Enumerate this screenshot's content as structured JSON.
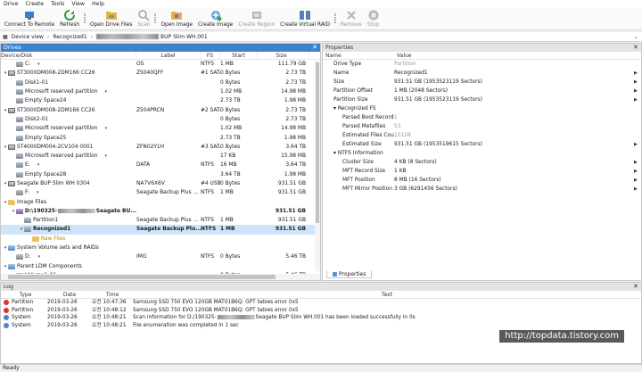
{
  "menu": [
    "Drive",
    "Create",
    "Tools",
    "View",
    "Help"
  ],
  "toolbar": [
    {
      "label": "Connect To Remote",
      "icon": "remote-icon",
      "color": "#3a7bd5",
      "disabled": false
    },
    {
      "label": "Refresh",
      "icon": "refresh-icon",
      "color": "#2e9b3a",
      "disabled": false
    },
    {
      "label": "Open Drive Files",
      "icon": "open-drive-icon",
      "color": "#e1b640",
      "disabled": false
    },
    {
      "label": "Scan",
      "icon": "scan-icon",
      "color": "#b5b5b5",
      "disabled": true
    },
    {
      "label": "Open Image",
      "icon": "open-image-icon",
      "color": "#e1b640",
      "disabled": false
    },
    {
      "label": "Create Image",
      "icon": "create-image-icon",
      "color": "#3aa34a",
      "disabled": false
    },
    {
      "label": "Create Region",
      "icon": "create-region-icon",
      "color": "#b5b5b5",
      "disabled": true
    },
    {
      "label": "Create Virtual RAID",
      "icon": "virtual-raid-icon",
      "color": "#5a7fb8",
      "disabled": false
    },
    {
      "label": "Remove",
      "icon": "remove-icon",
      "color": "#b5b5b5",
      "disabled": true
    },
    {
      "label": "Stop",
      "icon": "stop-icon",
      "color": "#b5b5b5",
      "disabled": true
    }
  ],
  "breadcrumb": {
    "device_view": "Device view",
    "recognized": "Recognized1",
    "image_tail": "BUP Slim WH.001"
  },
  "drives_pane": {
    "title": "Drives",
    "columns": [
      "Device/Disk",
      "Label",
      "FS",
      "Start",
      "Size"
    ],
    "rows": [
      {
        "indent": 1,
        "icon": "part",
        "name": "C:",
        "dd": true,
        "label": "OS",
        "fs": "NTFS",
        "start": "1 MB",
        "size": "111.79 GB"
      },
      {
        "indent": 0,
        "icon": "disk",
        "name": "ST3000DM008-2DM166 CC26",
        "tw": "v",
        "label": "Z5040QFF",
        "fs": "#1 SATA2...",
        "start": "0 Bytes",
        "size": "2.73 TB"
      },
      {
        "indent": 1,
        "icon": "part",
        "name": "Disk1-01",
        "label": "",
        "fs": "",
        "start": "0 Bytes",
        "size": "2.73 TB"
      },
      {
        "indent": 1,
        "icon": "part",
        "name": "Microsoft reserved partition",
        "dd": true,
        "label": "",
        "fs": "",
        "start": "1.02 MB",
        "size": "14.98 MB"
      },
      {
        "indent": 1,
        "icon": "part",
        "name": "Empty Space24",
        "label": "",
        "fs": "",
        "start": "2.73 TB",
        "size": "1.98 MB"
      },
      {
        "indent": 0,
        "icon": "disk",
        "name": "ST3000DM008-2DM166 CC26",
        "tw": "v",
        "label": "Z504PRCN",
        "fs": "#2 SATA2...",
        "start": "0 Bytes",
        "size": "2.73 TB"
      },
      {
        "indent": 1,
        "icon": "part",
        "name": "Disk2-01",
        "label": "",
        "fs": "",
        "start": "0 Bytes",
        "size": "2.73 TB"
      },
      {
        "indent": 1,
        "icon": "part",
        "name": "Microsoft reserved partition",
        "dd": true,
        "label": "",
        "fs": "",
        "start": "1.02 MB",
        "size": "14.98 MB"
      },
      {
        "indent": 1,
        "icon": "part",
        "name": "Empty Space25",
        "label": "",
        "fs": "",
        "start": "2.73 TB",
        "size": "1.98 MB"
      },
      {
        "indent": 0,
        "icon": "disk",
        "name": "ST4000DM004-2CV104 0001",
        "tw": "v",
        "label": "ZFN02Y1H",
        "fs": "#3 SATA2...",
        "start": "0 Bytes",
        "size": "3.64 TB"
      },
      {
        "indent": 1,
        "icon": "part",
        "name": "Microsoft reserved partition",
        "dd": true,
        "label": "",
        "fs": "",
        "start": "17 KB",
        "size": "15.98 MB"
      },
      {
        "indent": 1,
        "icon": "part",
        "name": "E:",
        "dd": true,
        "label": "DATA",
        "fs": "NTFS",
        "start": "16 MB",
        "size": "3.64 TB"
      },
      {
        "indent": 1,
        "icon": "part",
        "name": "Empty Space28",
        "label": "",
        "fs": "",
        "start": "3.64 TB",
        "size": "1.98 MB"
      },
      {
        "indent": 0,
        "icon": "disk",
        "name": "Seagate BUP Slim WH 0304",
        "tw": "v",
        "label": "NA7V6X6V",
        "fs": "#4 USB (...",
        "start": "0 Bytes",
        "size": "931.51 GB"
      },
      {
        "indent": 1,
        "icon": "part",
        "name": "F:",
        "dd": true,
        "label": "Seagate Backup Plus ...",
        "fs": "NTFS",
        "start": "1 MB",
        "size": "931.51 GB"
      },
      {
        "indent": 0,
        "icon": "folder",
        "name": "Image Files",
        "tw": "v",
        "label": "",
        "fs": "",
        "start": "",
        "size": ""
      },
      {
        "indent": 1,
        "icon": "img",
        "name": "D:\\190325-",
        "blur": true,
        "name_tail": "Seagate BU...",
        "tw": "v",
        "label": "",
        "fs": "",
        "start": "",
        "size": "931.51 GB",
        "bold": true
      },
      {
        "indent": 2,
        "icon": "part",
        "name": "Partition1",
        "label": "Seagate Backup Plus ...",
        "fs": "NTFS",
        "start": "1 MB",
        "size": "931.51 GB"
      },
      {
        "indent": 2,
        "icon": "part",
        "name": "Recognized1",
        "tw": "v",
        "label": "Seagate Backup Plu...",
        "fs": "NTFS",
        "start": "1 MB",
        "size": "931.51 GB",
        "sel": true,
        "bold": true
      },
      {
        "indent": 3,
        "icon": "raw",
        "name": "Raw Files",
        "label": "",
        "fs": "",
        "start": "",
        "size": "",
        "raw": true
      },
      {
        "indent": 0,
        "icon": "grp",
        "name": "System Volume sets and RAIDs",
        "tw": "v",
        "label": "",
        "fs": "",
        "start": "",
        "size": ""
      },
      {
        "indent": 1,
        "icon": "part",
        "name": "D:",
        "dd": true,
        "label": "IMG",
        "fs": "NTFS",
        "start": "0 Bytes",
        "size": "5.46 TB"
      },
      {
        "indent": 0,
        "icon": "grp",
        "name": "Parent LDM Components",
        "tw": "v",
        "label": "",
        "fs": "",
        "start": "",
        "size": ""
      },
      {
        "indent": 1,
        "icon": "part",
        "name": "Volume1-01",
        "label": "",
        "fs": "",
        "start": "0 Bytes",
        "size": "5.46 TB"
      }
    ]
  },
  "properties_pane": {
    "title": "Properties",
    "columns": [
      "Name",
      "Value"
    ],
    "tab": "Properties",
    "rows": [
      {
        "kind": "item",
        "name": "Drive Type",
        "value": "Partition",
        "muted": true
      },
      {
        "kind": "item",
        "name": "Name",
        "value": "Recognized1",
        "arrow": true
      },
      {
        "kind": "item",
        "name": "Size",
        "value": "931.51 GB (1953523119 Sectors)",
        "arrow": true
      },
      {
        "kind": "item",
        "name": "Partition Offset",
        "value": "1 MB (2048 Sectors)",
        "arrow": true
      },
      {
        "kind": "item",
        "name": "Partition Size",
        "value": "931.51 GB (1953523119 Sectors)",
        "arrow": true
      },
      {
        "kind": "group",
        "name": "Recognized FS"
      },
      {
        "kind": "sub",
        "name": "Parsed Boot Records",
        "value": "1",
        "muted": true
      },
      {
        "kind": "sub",
        "name": "Parsed Metafiles",
        "value": "53",
        "muted": true
      },
      {
        "kind": "sub",
        "name": "Estimated Files Count",
        "value": "10128",
        "muted": true
      },
      {
        "kind": "sub",
        "name": "Estimated Size",
        "value": "931.51 GB (1953519615 Sectors)",
        "arrow": true
      },
      {
        "kind": "group",
        "name": "NTFS Information"
      },
      {
        "kind": "sub",
        "name": "Cluster Size",
        "value": "4 KB (8 Sectors)",
        "arrow": true
      },
      {
        "kind": "sub",
        "name": "MFT Record Size",
        "value": "1 KB",
        "arrow": true
      },
      {
        "kind": "sub",
        "name": "MFT Position",
        "value": "8 MB (16 Sectors)",
        "arrow": true
      },
      {
        "kind": "sub",
        "name": "MFT Mirror Position",
        "value": "3 GB (6291456 Sectors)",
        "arrow": true
      }
    ]
  },
  "log_pane": {
    "title": "Log",
    "columns": [
      "Type",
      "Date",
      "Time",
      "Text"
    ],
    "rows": [
      {
        "type": "Partition",
        "level": "err",
        "date": "2019-03-26",
        "time": "오전 10:47:36",
        "text": "Samsung SSD 750 EVO 120GB MAT01B6Q: GPT tables error 0x5"
      },
      {
        "type": "Partition",
        "level": "err",
        "date": "2019-03-26",
        "time": "오전 10:48:12",
        "text": "Samsung SSD 750 EVO 120GB MAT01B6Q: GPT tables error 0x5"
      },
      {
        "type": "System",
        "level": "info",
        "date": "2019-03-26",
        "time": "오전 10:48:21",
        "text": "Scan information for D:/190325-",
        "text_tail": "Seagate BUP Slim WH.001 has been loaded successfully in 0s",
        "blur": true
      },
      {
        "type": "System",
        "level": "info",
        "date": "2019-03-26",
        "time": "오전 10:48:21",
        "text": "File enumeration was completed in 1 sec"
      }
    ]
  },
  "watermark": "http://topdata.tistory.com",
  "status": "Ready"
}
